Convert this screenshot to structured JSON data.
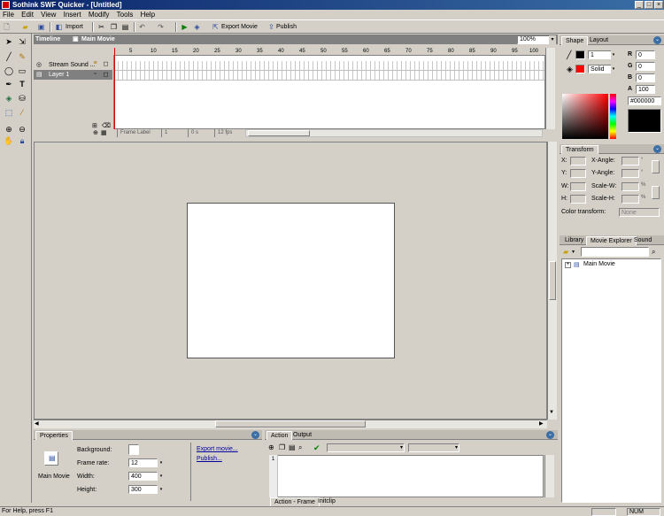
{
  "window": {
    "title": "Sothink SWF Quicker - [Untitled]",
    "minimize": "_",
    "maximize": "□",
    "close": "×"
  },
  "menu": [
    "File",
    "Edit",
    "View",
    "Insert",
    "Modify",
    "Tools",
    "Help"
  ],
  "toolbar": {
    "import": "Import",
    "export_movie": "Export Movie",
    "publish": "Publish"
  },
  "timeline": {
    "title": "Timeline",
    "scene": "Main Movie",
    "zoom": "100%",
    "ruler": [
      "5",
      "10",
      "15",
      "20",
      "25",
      "30",
      "35",
      "40",
      "45",
      "50",
      "55",
      "60",
      "65",
      "70",
      "75",
      "80",
      "85",
      "90",
      "95",
      "100"
    ],
    "layers": [
      "Stream Sound ...",
      "Layer 1"
    ],
    "status": {
      "frame_label": "Frame Label",
      "frame": "1",
      "time": "0 s",
      "fps": "12 fps"
    }
  },
  "properties": {
    "tab": "Properties",
    "item": "Main Movie",
    "background_label": "Background:",
    "frame_rate_label": "Frame rate:",
    "frame_rate": "12",
    "width_label": "Width:",
    "width": "400",
    "height_label": "Height:",
    "height": "300",
    "export_link": "Export movie...",
    "publish_link": "Publish..."
  },
  "action": {
    "tabs": [
      "Action",
      "Output"
    ],
    "line": "1",
    "bottom_tabs": [
      "Action - Frame",
      "Initclip"
    ]
  },
  "shape": {
    "tabs": [
      "Shape",
      "Layout"
    ],
    "stroke_width": "1",
    "fill_type": "Solid",
    "r_label": "R",
    "r": "0",
    "g_label": "G",
    "g": "0",
    "b_label": "B",
    "b": "0",
    "a_label": "A",
    "a": "100",
    "hex": "#000000"
  },
  "transform": {
    "tab": "Transform",
    "x_label": "X:",
    "y_label": "Y:",
    "w_label": "W:",
    "h_label": "H:",
    "x_angle": "X-Angle:",
    "y_angle": "Y-Angle:",
    "scale_w": "Scale-W:",
    "scale_h": "Scale-H:",
    "color_transform": "Color transform:",
    "color_transform_value": "None"
  },
  "library": {
    "tabs": [
      "Library",
      "Movie Explorer",
      "Sound"
    ],
    "tree_item": "Main Movie"
  },
  "status": {
    "help": "For Help, press F1",
    "num": "NUM"
  },
  "colors": {
    "title_start": "#0a246a",
    "title_end": "#3a6ea5",
    "playhead": "#e00000",
    "accent_red": "#ff0000"
  }
}
